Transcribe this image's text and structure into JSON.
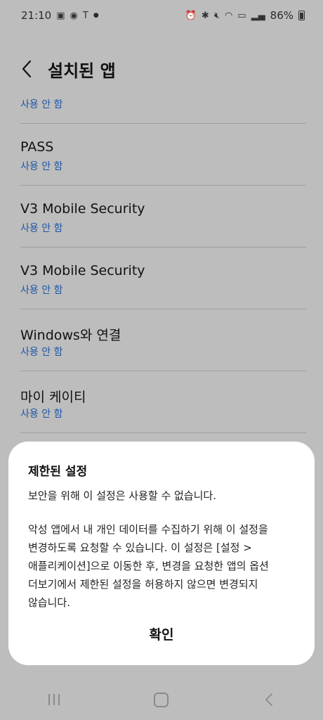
{
  "status_bar": {
    "time": "21:10",
    "battery": "86%"
  },
  "header": {
    "back_icon": "chevron-left-icon",
    "title": "설치된 앱"
  },
  "app_list": {
    "items": [
      {
        "name": "",
        "status": "사용 안 함"
      },
      {
        "name": "PASS",
        "status": "사용 안 함"
      },
      {
        "name": "V3 Mobile Security",
        "status": "사용 안 함"
      },
      {
        "name": "V3 Mobile Security",
        "status": "사용 안 함"
      },
      {
        "name": "Windows와 연결",
        "status": "사용 안 함"
      },
      {
        "name": "마이 케이티",
        "status": "사용 안 함"
      }
    ],
    "status_color": "#1f57a8"
  },
  "dialog": {
    "title": "제한된 설정",
    "line1": "보안을 위해 이 설정은 사용할 수 없습니다.",
    "body_lines": [
      "악성 앱에서 내 개인 데이터를 수집하기 위해 이 설정을",
      "변경하도록 요청할 수 있습니다. 이 설정은 [설정 >",
      "애플리케이션]으로 이동한 후, 변경을 요청한 앱의 옵션",
      "더보기에서 제한된 설정을 허용하지 않으면 변경되지",
      "않습니다."
    ],
    "confirm_label": "확인"
  },
  "nav_bar": {
    "recent_icon": "recent-apps-icon",
    "home_icon": "home-icon",
    "back_icon": "back-icon"
  }
}
